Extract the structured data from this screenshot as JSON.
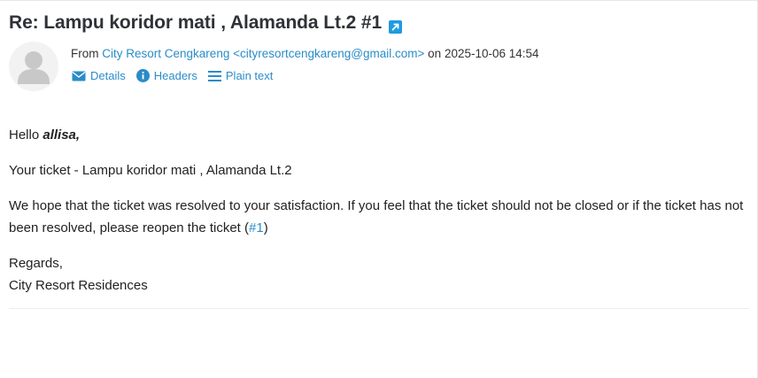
{
  "email": {
    "subject": "Re: Lampu koridor mati , Alamanda Lt.2 #1",
    "from_label": "From",
    "sender_name": "City Resort Cengkareng",
    "sender_email": "<cityresortcengkareng@gmail.com>",
    "on_label": "on",
    "date": "2025-10-06 14:54",
    "links": {
      "details": "Details",
      "headers": "Headers",
      "plain_text": "Plain text"
    },
    "body": {
      "greeting": "Hello",
      "recipient": "allisa,",
      "ticket_line": "Your ticket - Lampu koridor mati , Alamanda Lt.2",
      "message_before_link": "We hope that the ticket was resolved to your satisfaction. If you feel that the ticket should not be closed or if the ticket has not been resolved, please reopen the ticket (",
      "ticket_link": "#1",
      "message_after_link": ")",
      "regards": "Regards,",
      "signature": "City Resort Residences"
    }
  },
  "colors": {
    "link": "#2a8cc8",
    "title": "#2f3237",
    "icon_blue": "#1f9be0"
  },
  "icons": {
    "open_new": "external-link-icon",
    "details": "envelope-icon",
    "headers": "info-icon",
    "plain_text": "list-icon",
    "avatar": "user-placeholder-icon"
  }
}
